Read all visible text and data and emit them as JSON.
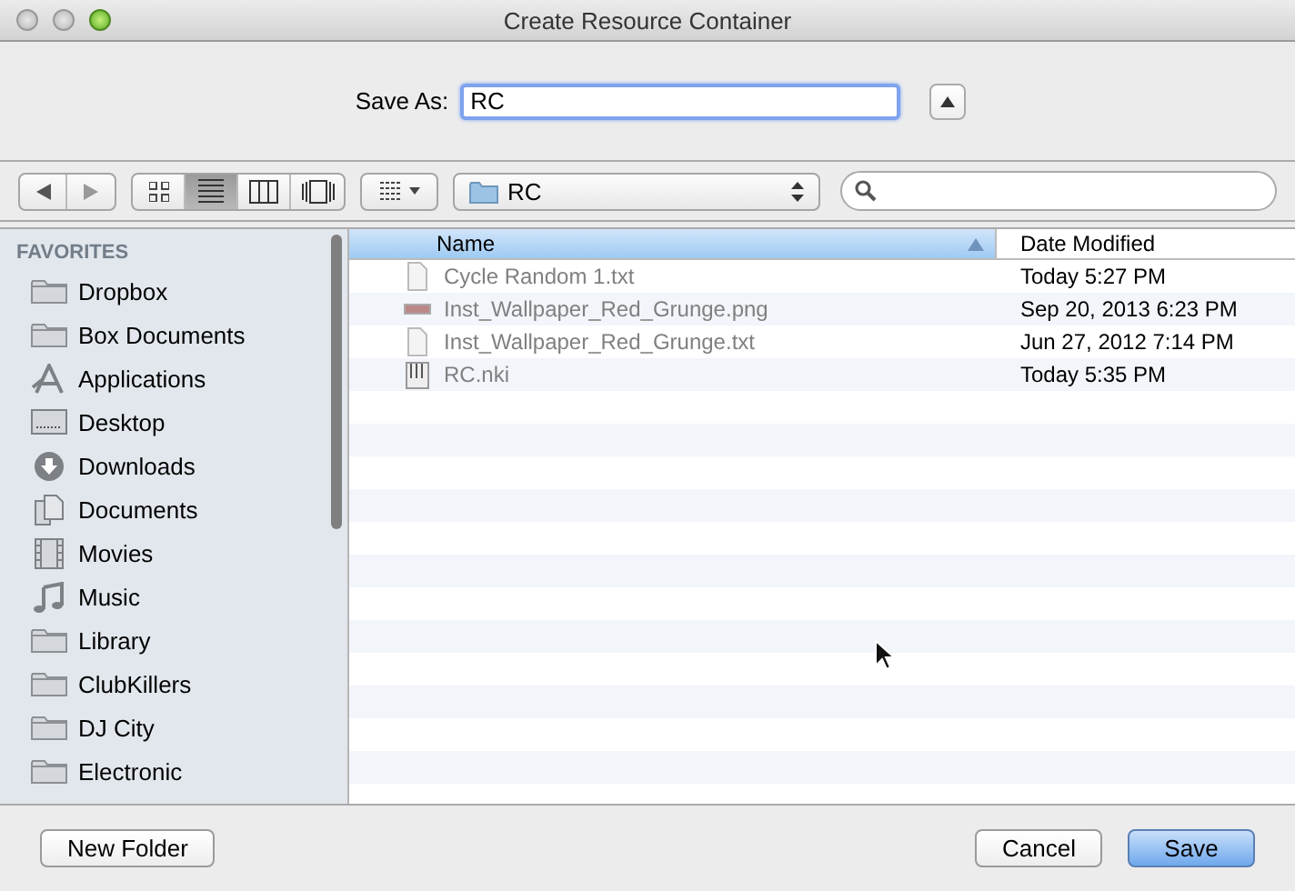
{
  "window": {
    "title": "Create Resource Container"
  },
  "save_as": {
    "label": "Save As:",
    "value": "RC"
  },
  "toolbar": {
    "view_buttons": [
      {
        "kind": "icon",
        "selected": false
      },
      {
        "kind": "list",
        "selected": true
      },
      {
        "kind": "column",
        "selected": false
      },
      {
        "kind": "coverflow",
        "selected": false
      }
    ],
    "location": "RC"
  },
  "sidebar": {
    "heading": "FAVORITES",
    "items": [
      {
        "label": "Dropbox",
        "kind": "folder"
      },
      {
        "label": "Box Documents",
        "kind": "folder"
      },
      {
        "label": "Applications",
        "kind": "apps"
      },
      {
        "label": "Desktop",
        "kind": "desktop"
      },
      {
        "label": "Downloads",
        "kind": "downloads"
      },
      {
        "label": "Documents",
        "kind": "documents"
      },
      {
        "label": "Movies",
        "kind": "movies"
      },
      {
        "label": "Music",
        "kind": "music"
      },
      {
        "label": "Library",
        "kind": "folder"
      },
      {
        "label": "ClubKillers",
        "kind": "folder"
      },
      {
        "label": "DJ City",
        "kind": "folder"
      },
      {
        "label": "Electronic",
        "kind": "folder"
      }
    ]
  },
  "table": {
    "columns": [
      {
        "label": "Name",
        "sorted": true
      },
      {
        "label": "Date Modified",
        "sorted": false
      }
    ],
    "rows": [
      {
        "name": "Cycle Random 1.txt",
        "date": "Today 5:27 PM",
        "kind": "text",
        "disabled": true
      },
      {
        "name": "Inst_Wallpaper_Red_Grunge.png",
        "date": "Sep 20, 2013 6:23 PM",
        "kind": "image",
        "disabled": true
      },
      {
        "name": "Inst_Wallpaper_Red_Grunge.txt",
        "date": "Jun 27, 2012 7:14 PM",
        "kind": "text",
        "disabled": true
      },
      {
        "name": "RC.nki",
        "date": "Today 5:35 PM",
        "kind": "nki",
        "disabled": true
      }
    ]
  },
  "buttons": [
    {
      "label": "New Folder",
      "kind": "plain"
    },
    {
      "label": "Cancel",
      "kind": "plain"
    },
    {
      "label": "Save",
      "kind": "default"
    }
  ]
}
